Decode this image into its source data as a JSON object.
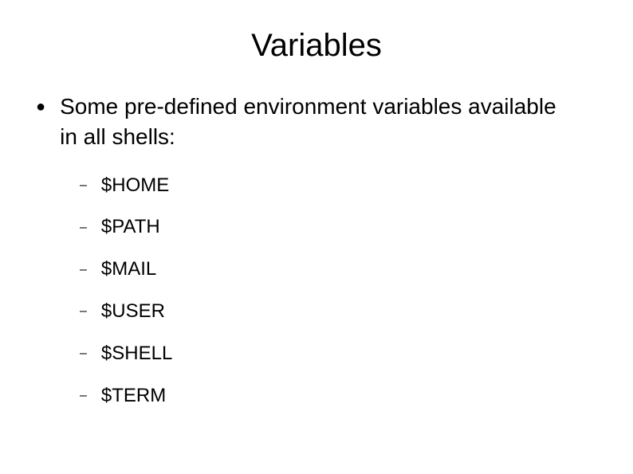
{
  "title": "Variables",
  "main_bullet": "Some pre-defined environment variables available in all shells:",
  "variables": [
    "$HOME",
    "$PATH",
    "$MAIL",
    "$USER",
    "$SHELL",
    "$TERM"
  ]
}
